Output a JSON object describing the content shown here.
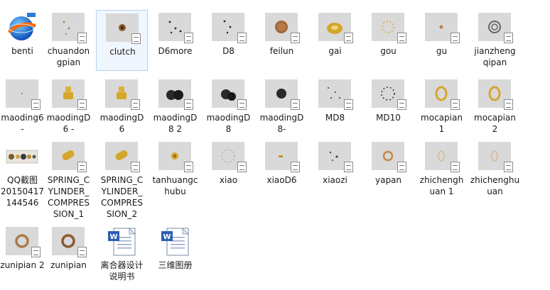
{
  "window": {
    "title": ""
  },
  "files": [
    {
      "label": "benti",
      "icon": "app-globe-icon"
    },
    {
      "label": "chuandon\ngpian",
      "icon": "model-thumbnail-icon"
    },
    {
      "label": "clutch",
      "icon": "model-thumbnail-icon",
      "selected": true
    },
    {
      "label": "D6more",
      "icon": "model-thumbnail-icon"
    },
    {
      "label": "D8",
      "icon": "model-thumbnail-icon"
    },
    {
      "label": "feilun",
      "icon": "model-thumbnail-icon"
    },
    {
      "label": "gai",
      "icon": "model-thumbnail-icon"
    },
    {
      "label": "gou",
      "icon": "model-thumbnail-icon"
    },
    {
      "label": "gu",
      "icon": "model-thumbnail-icon"
    },
    {
      "label": "jianzheng\nqipan",
      "icon": "model-thumbnail-icon"
    },
    {
      "label": "maoding6\n-",
      "icon": "model-thumbnail-icon"
    },
    {
      "label": "maodingD\n6 -",
      "icon": "model-thumbnail-icon"
    },
    {
      "label": "maodingD\n6",
      "icon": "model-thumbnail-icon"
    },
    {
      "label": "maodingD\n8   2",
      "icon": "model-thumbnail-icon"
    },
    {
      "label": "maodingD\n8",
      "icon": "model-thumbnail-icon"
    },
    {
      "label": "maodingD\n8-",
      "icon": "model-thumbnail-icon"
    },
    {
      "label": "MD8",
      "icon": "model-thumbnail-icon"
    },
    {
      "label": "MD10",
      "icon": "model-thumbnail-icon"
    },
    {
      "label": "mocapian\n1",
      "icon": "model-thumbnail-icon"
    },
    {
      "label": "mocapian\n2",
      "icon": "model-thumbnail-icon"
    },
    {
      "label": "QQ截图\n20150417\n144546",
      "icon": "image-thumbnail-icon"
    },
    {
      "label": "SPRING_C\nYLINDER_\nCOMPRES\nSION_1",
      "icon": "model-thumbnail-icon"
    },
    {
      "label": "SPRING_C\nYLINDER_\nCOMPRES\nSION_2",
      "icon": "model-thumbnail-icon"
    },
    {
      "label": "tanhuangc\nhubu",
      "icon": "model-thumbnail-icon"
    },
    {
      "label": "xiao",
      "icon": "model-thumbnail-icon"
    },
    {
      "label": "xiaoD6",
      "icon": "model-thumbnail-icon"
    },
    {
      "label": "xiaozi",
      "icon": "model-thumbnail-icon"
    },
    {
      "label": "yapan",
      "icon": "model-thumbnail-icon"
    },
    {
      "label": "zhichengh\nuan 1",
      "icon": "model-thumbnail-icon"
    },
    {
      "label": "zhichenghu\nuan",
      "icon": "model-thumbnail-icon"
    },
    {
      "label": "zunipian 2",
      "icon": "model-thumbnail-icon"
    },
    {
      "label": "zunipian",
      "icon": "model-thumbnail-icon"
    },
    {
      "label": "离合器设计\n说明书",
      "icon": "word-document-icon"
    },
    {
      "label": "三维图册",
      "icon": "word-document-icon"
    }
  ],
  "colors": {
    "selection_bg": "#f0f6fd",
    "selection_border": "#b8d4f0",
    "thumb_bg": "#d9d9d9",
    "gold": "#d4a62a",
    "dark": "#2a2a2a"
  }
}
